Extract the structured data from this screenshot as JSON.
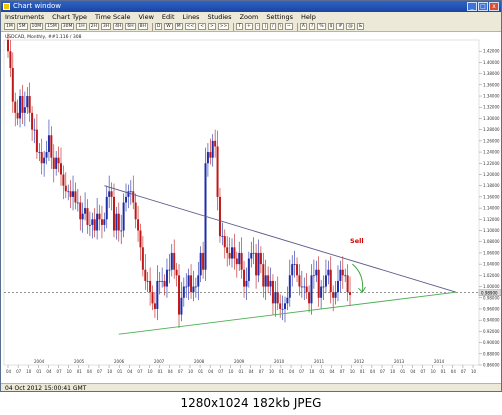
{
  "window": {
    "title": "Chart window"
  },
  "menu": [
    "Instruments",
    "Chart Type",
    "Time Scale",
    "View",
    "Edit",
    "Lines",
    "Studies",
    "Zoom",
    "Settings",
    "Help"
  ],
  "toolbar": {
    "buttons": [
      "1M",
      "5M",
      "10M",
      "15M",
      "30M",
      "1H",
      "2H",
      "3H",
      "4H",
      "6H",
      "8H",
      "D",
      "W",
      "M",
      "<<",
      "<",
      ">",
      ">>",
      "T",
      "+",
      "-",
      "|",
      "/",
      "\\",
      "~",
      "A",
      "?",
      "%",
      "$",
      "#",
      "@",
      "&"
    ]
  },
  "chart_header": "USDCAD, Monthly, ##1.116 / 308",
  "status": "04 Oct 2012 15:00:41 GMT",
  "caption": {
    "dimensions": "1280x1024",
    "size": "182kb",
    "format": "JPEG"
  },
  "annotation": {
    "label": "Sell",
    "color": "#cc0000"
  },
  "colors": {
    "bull": "#1f2ea8",
    "bear": "#c01818",
    "trend_upper": "#5a5a88",
    "trend_lower": "#4caf50",
    "arrow": "#2e9f2e",
    "price_line": "#555555"
  },
  "chart_data": {
    "type": "candlestick",
    "title": "USDCAD, Monthly",
    "y_axis": {
      "min": 0.86,
      "max": 1.44,
      "ticks": [
        "1.42000",
        "1.40000",
        "1.38000",
        "1.36000",
        "1.34000",
        "1.32000",
        "1.30000",
        "1.28000",
        "1.26000",
        "1.24000",
        "1.22000",
        "1.20000",
        "1.18000",
        "1.16000",
        "1.14000",
        "1.12000",
        "1.10000",
        "1.08000",
        "1.06000",
        "1.04000",
        "1.02000",
        "1.00000",
        "0.98000",
        "0.96000",
        "0.94000",
        "0.92000",
        "0.90000",
        "0.88000",
        "0.86000"
      ]
    },
    "current_price": {
      "value": 0.989,
      "label": "0.98900"
    },
    "x_axis": {
      "ticks": [
        "04",
        "07",
        "10",
        "01",
        "04",
        "07",
        "10",
        "01",
        "04",
        "07",
        "10",
        "01",
        "04",
        "07",
        "10",
        "01",
        "04",
        "07",
        "10",
        "01",
        "04",
        "07",
        "10",
        "01",
        "04",
        "07",
        "10",
        "01",
        "04",
        "07",
        "10",
        "01",
        "04",
        "07",
        "10",
        "01",
        "04",
        "07",
        "10",
        "01",
        "04",
        "07",
        "10",
        "01",
        "04",
        "07",
        "10"
      ],
      "years": [
        "2004",
        "2005",
        "2006",
        "2007",
        "2008",
        "2009",
        "2010",
        "2011",
        "2012",
        "2013",
        "2014"
      ]
    },
    "closes": [
      1.42,
      1.39,
      1.33,
      1.31,
      1.3,
      1.34,
      1.31,
      1.32,
      1.34,
      1.31,
      1.28,
      1.28,
      1.24,
      1.24,
      1.22,
      1.23,
      1.24,
      1.27,
      1.23,
      1.21,
      1.23,
      1.22,
      1.2,
      1.18,
      1.17,
      1.17,
      1.16,
      1.17,
      1.15,
      1.15,
      1.12,
      1.13,
      1.14,
      1.11,
      1.11,
      1.12,
      1.1,
      1.13,
      1.12,
      1.11,
      1.12,
      1.16,
      1.17,
      1.16,
      1.1,
      1.13,
      1.1,
      1.1,
      1.15,
      1.16,
      1.17,
      1.17,
      1.15,
      1.12,
      1.1,
      1.07,
      1.03,
      1.01,
      1.01,
      0.99,
      0.97,
      0.96,
      1.01,
      1.01,
      1.01,
      1.0,
      1.03,
      1.03,
      1.06,
      1.03,
      1.02,
      0.95,
      0.98,
      1.0,
      1.0,
      1.02,
      0.99,
      1.0,
      1.0,
      1.02,
      1.06,
      1.03,
      1.22,
      1.24,
      1.23,
      1.26,
      1.25,
      1.16,
      1.09,
      1.09,
      1.07,
      1.06,
      1.05,
      1.07,
      1.05,
      1.04,
      1.06,
      1.03,
      1.0,
      1.01,
      1.05,
      1.06,
      1.06,
      1.02,
      1.06,
      1.04,
      1.0,
      1.02,
      1.0,
      1.01,
      0.97,
      0.99,
      0.97,
      0.96,
      0.96,
      0.97,
      0.98,
      1.02,
      1.04,
      1.04,
      1.02,
      1.0,
      1.0,
      1.0,
      0.99,
      0.97,
      1.02,
      1.02,
      1.03,
      0.98,
      1.0,
      1.0,
      1.02,
      1.03,
      0.99,
      0.98,
      0.99,
      1.01,
      1.03,
      1.02,
      1.02,
      0.99,
      0.985
    ],
    "trendlines": [
      {
        "name": "upper",
        "from": {
          "i": 40,
          "price": 1.18
        },
        "to": {
          "i": 186,
          "price": 0.99
        }
      },
      {
        "name": "lower",
        "from": {
          "i": 46,
          "price": 0.915
        },
        "to": {
          "i": 186,
          "price": 0.99
        }
      }
    ]
  }
}
